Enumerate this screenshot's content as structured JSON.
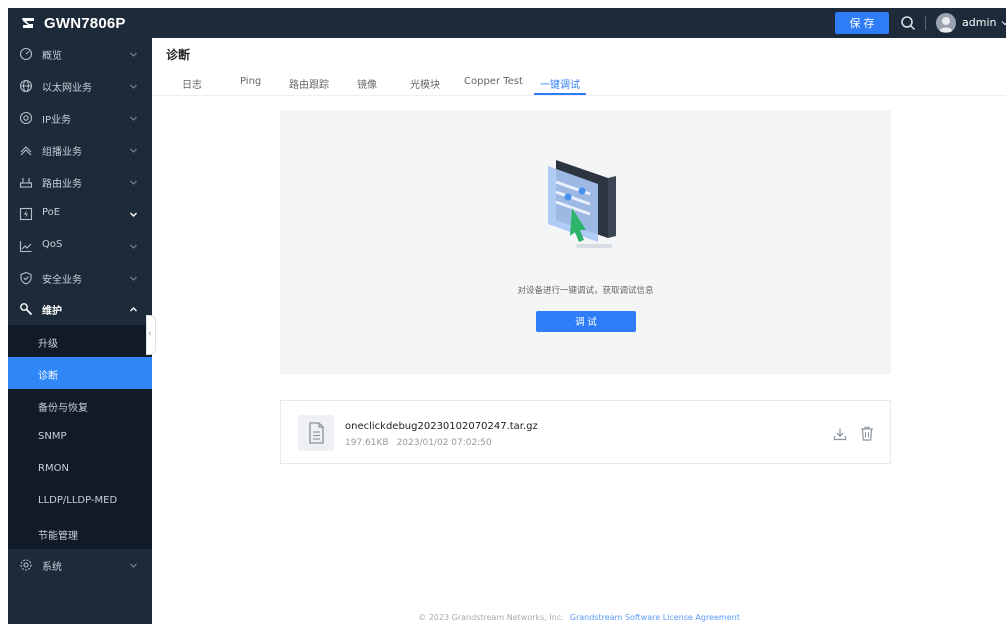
{
  "header": {
    "model": "GWN7806P",
    "save_label": "保 存",
    "username": "admin"
  },
  "sidebar": {
    "items": [
      {
        "label": "概览",
        "icon": "dashboard-icon"
      },
      {
        "label": "以太网业务",
        "icon": "globe-icon"
      },
      {
        "label": "IP业务",
        "icon": "target-icon"
      },
      {
        "label": "组播业务",
        "icon": "multicast-icon"
      },
      {
        "label": "路由业务",
        "icon": "router-icon"
      },
      {
        "label": "PoE",
        "icon": "poe-icon"
      },
      {
        "label": "QoS",
        "icon": "chart-icon"
      },
      {
        "label": "安全业务",
        "icon": "shield-icon"
      },
      {
        "label": "维护",
        "icon": "wrench-icon"
      },
      {
        "label": "系统",
        "icon": "gear-icon"
      }
    ],
    "maintenance_submenu": [
      {
        "label": "升级"
      },
      {
        "label": "诊断"
      },
      {
        "label": "备份与恢复"
      },
      {
        "label": "SNMP"
      },
      {
        "label": "RMON"
      },
      {
        "label": "LLDP/LLDP-MED"
      },
      {
        "label": "节能管理"
      }
    ]
  },
  "page": {
    "title": "诊断",
    "tabs": [
      "日志",
      "Ping",
      "路由跟踪",
      "镜像",
      "光模块",
      "Copper Test",
      "一键调试"
    ],
    "active_tab": "一键调试"
  },
  "one_click": {
    "description": "对设备进行一键调试，获取调试信息",
    "button_label": "调 试"
  },
  "file": {
    "name": "oneclickdebug20230102070247.tar.gz",
    "size": "197.61KB",
    "time": "2023/01/02 07:02:50"
  },
  "footer": {
    "copyright": "© 2023 Grandstream Networks, Inc.",
    "license_link": "Grandstream Software License Agreement"
  },
  "colors": {
    "accent": "#2f7df6",
    "sidebar_bg": "#1d2a3a",
    "submenu_bg": "#111b27",
    "panel_bg": "#f4f5f7"
  }
}
